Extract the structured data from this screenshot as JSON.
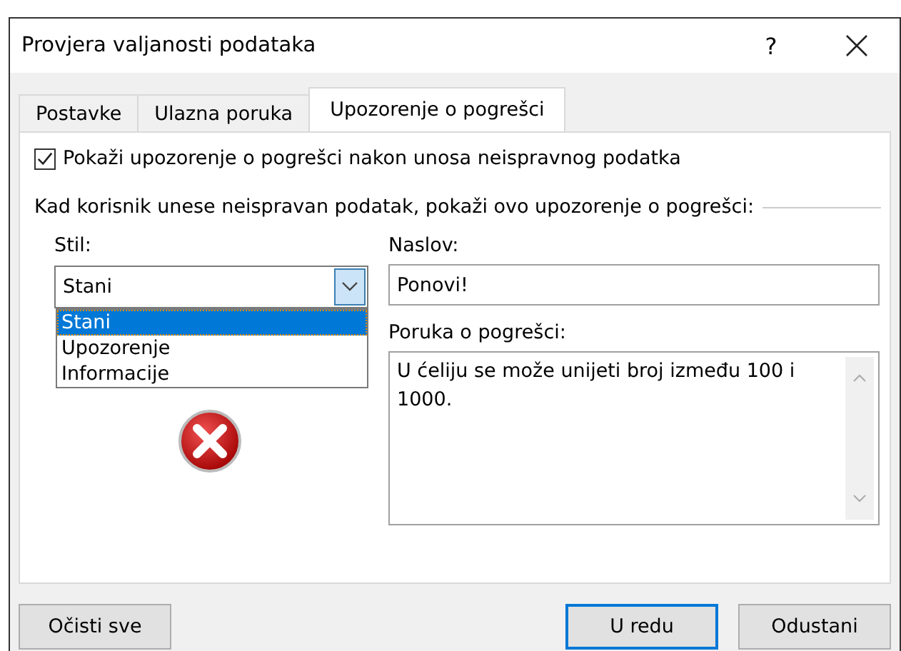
{
  "window": {
    "title": "Provjera valjanosti podataka",
    "help": "?"
  },
  "tabs": [
    {
      "label": "Postavke",
      "selected": false
    },
    {
      "label": "Ulazna poruka",
      "selected": false
    },
    {
      "label": "Upozorenje o pogrešci",
      "selected": true
    }
  ],
  "show_error_checkbox": {
    "label": "Pokaži upozorenje o pogrešci nakon unosa neispravnog podatka",
    "checked": true
  },
  "section_heading": "Kad korisnik unese neispravan podatak, pokaži ovo upozorenje o pogrešci:",
  "style": {
    "label": "Stil:",
    "value": "Stani",
    "expanded": true,
    "options": [
      {
        "label": "Stani",
        "selected": true
      },
      {
        "label": "Upozorenje",
        "selected": false
      },
      {
        "label": "Informacije",
        "selected": false
      }
    ]
  },
  "title_field": {
    "label": "Naslov:",
    "value": "Ponovi!"
  },
  "message_field": {
    "label": "Poruka o pogrešci:",
    "value": "U ćeliju se može unijeti broj između 100 i 1000."
  },
  "buttons": [
    {
      "label": "Očisti sve",
      "kind": "left",
      "default": false
    },
    {
      "label": "U redu",
      "kind": "right",
      "default": true
    },
    {
      "label": "Odustani",
      "kind": "right",
      "default": false
    }
  ]
}
